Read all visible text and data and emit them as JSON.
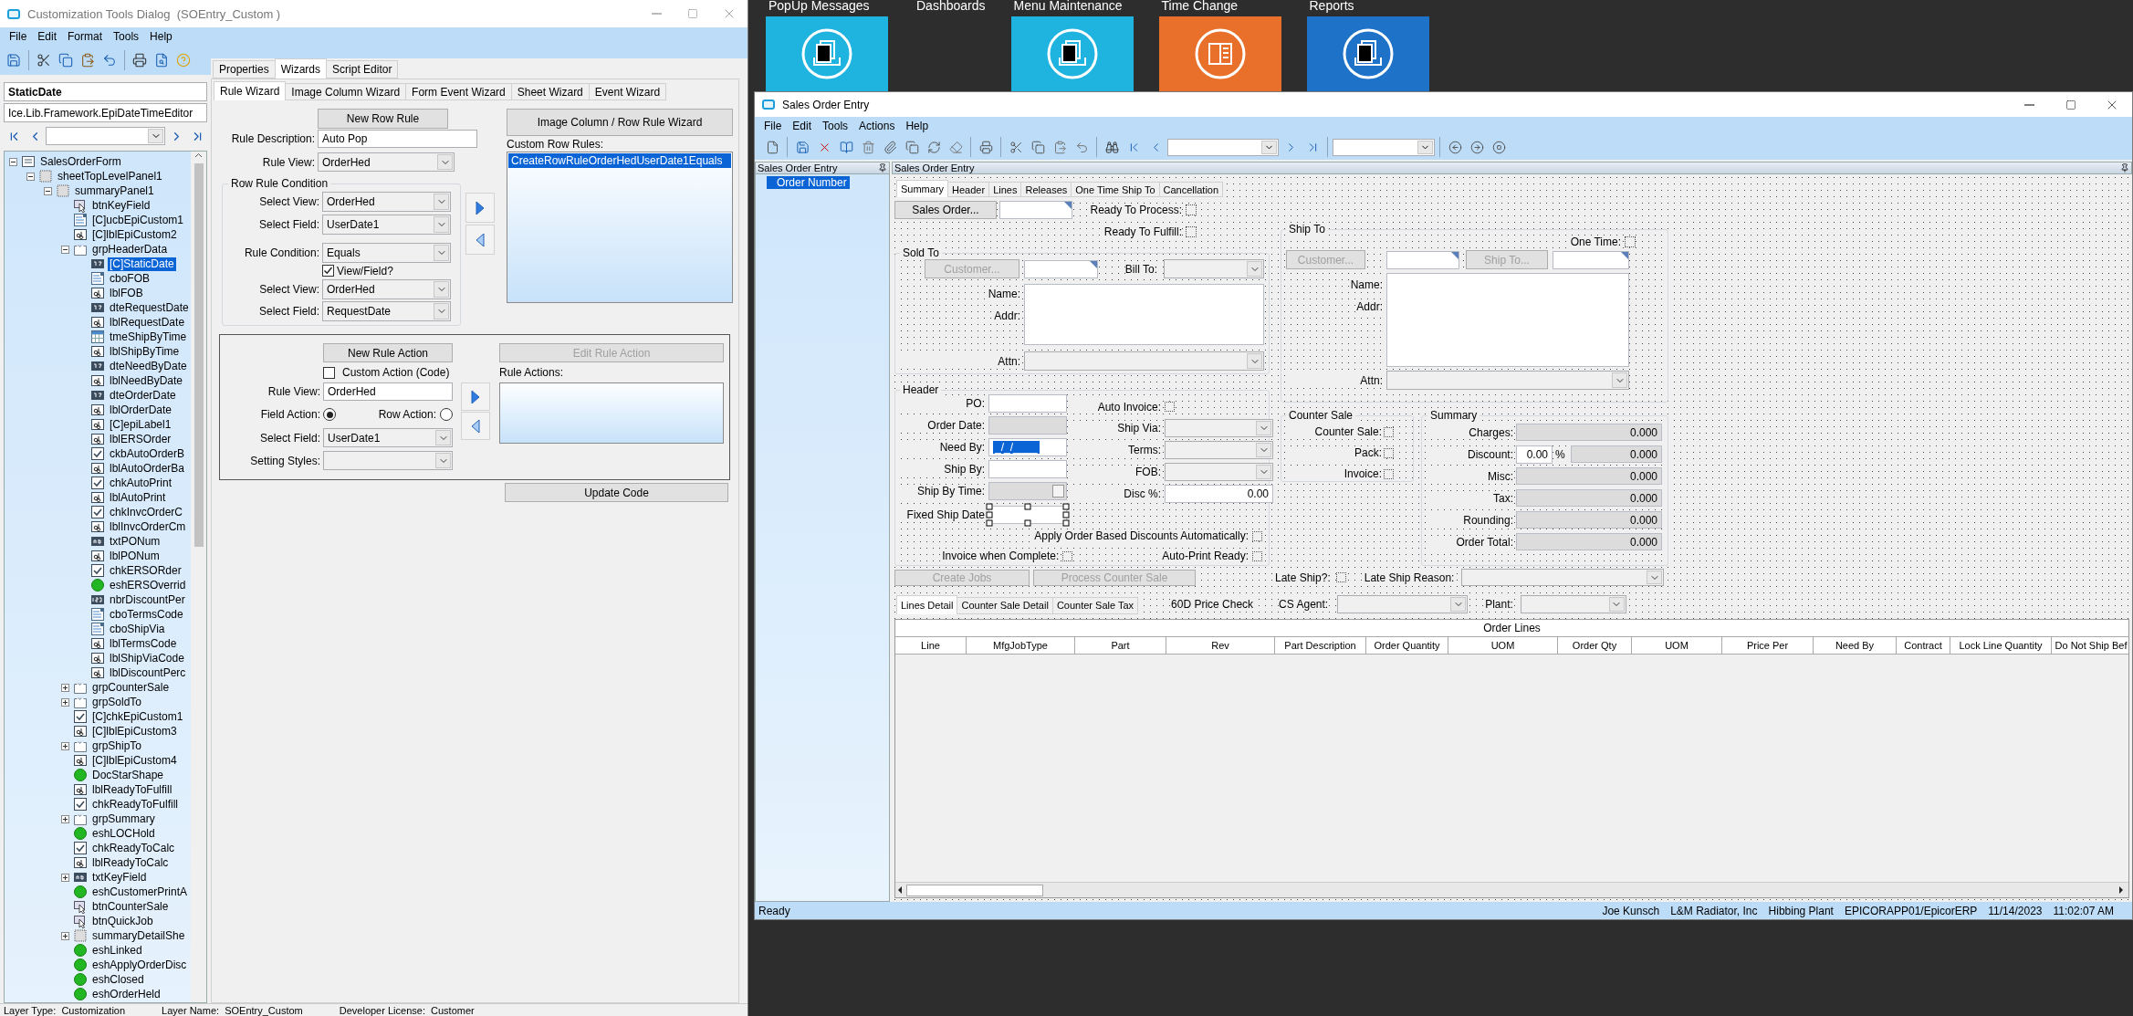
{
  "customization_dialog": {
    "title": "Customization Tools Dialog  (SOEntry_Custom )",
    "menu": [
      "File",
      "Edit",
      "Format",
      "Tools",
      "Help"
    ],
    "control_name": "StaticDate",
    "control_type": "Ice.Lib.Framework.EpiDateTimeEditor",
    "tree": [
      {
        "label": "SalesOrderForm",
        "kind": "form",
        "expanded": true,
        "selected": false,
        "children": [
          {
            "label": "sheetTopLevelPanel1",
            "kind": "panel",
            "expanded": true,
            "selected": false,
            "children": [
              {
                "label": "summaryPanel1",
                "kind": "panel",
                "expanded": true,
                "selected": false,
                "children": [
                  {
                    "label": "btnKeyField",
                    "kind": "button",
                    "selected": false
                  },
                  {
                    "label": "[C]ucbEpiCustom1",
                    "kind": "combo",
                    "selected": false
                  },
                  {
                    "label": "[C]lblEpiCustom2",
                    "kind": "label",
                    "selected": false
                  },
                  {
                    "label": "grpHeaderData",
                    "kind": "group",
                    "expanded": true,
                    "selected": false,
                    "children": [
                      {
                        "label": "[C]StaticDate",
                        "kind": "date",
                        "selected": true
                      },
                      {
                        "label": "cboFOB",
                        "kind": "combo",
                        "selected": false
                      },
                      {
                        "label": "lblFOB",
                        "kind": "label",
                        "selected": false
                      },
                      {
                        "label": "dteRequestDate",
                        "kind": "date",
                        "selected": false
                      },
                      {
                        "label": "lblRequestDate",
                        "kind": "label",
                        "selected": false
                      },
                      {
                        "label": "tmeShipByTime",
                        "kind": "time",
                        "selected": false
                      },
                      {
                        "label": "lblShipByTime",
                        "kind": "label",
                        "selected": false
                      },
                      {
                        "label": "dteNeedByDate",
                        "kind": "date",
                        "selected": false
                      },
                      {
                        "label": "lblNeedByDate",
                        "kind": "label",
                        "selected": false
                      },
                      {
                        "label": "dteOrderDate",
                        "kind": "date",
                        "selected": false
                      },
                      {
                        "label": "lblOrderDate",
                        "kind": "label",
                        "selected": false
                      },
                      {
                        "label": "[C]epiLabel1",
                        "kind": "label",
                        "selected": false
                      },
                      {
                        "label": "lblERSOrder",
                        "kind": "label",
                        "selected": false
                      },
                      {
                        "label": "ckbAutoOrderB",
                        "kind": "check",
                        "selected": false
                      },
                      {
                        "label": "lblAutoOrderBa",
                        "kind": "label",
                        "selected": false
                      },
                      {
                        "label": "chkAutoPrint",
                        "kind": "check",
                        "selected": false
                      },
                      {
                        "label": "lblAutoPrint",
                        "kind": "label",
                        "selected": false
                      },
                      {
                        "label": "chkInvcOrderC",
                        "kind": "check",
                        "selected": false
                      },
                      {
                        "label": "lblInvcOrderCm",
                        "kind": "label",
                        "selected": false
                      },
                      {
                        "label": "txtPONum",
                        "kind": "text",
                        "selected": false
                      },
                      {
                        "label": "lblPONum",
                        "kind": "label",
                        "selected": false
                      },
                      {
                        "label": "chkERSORder",
                        "kind": "check",
                        "selected": false
                      },
                      {
                        "label": "eshERSOverrid",
                        "kind": "shape",
                        "selected": false
                      },
                      {
                        "label": "nbrDiscountPer",
                        "kind": "number",
                        "selected": false
                      },
                      {
                        "label": "cboTermsCode",
                        "kind": "combo",
                        "selected": false
                      },
                      {
                        "label": "cboShipVia",
                        "kind": "combo",
                        "selected": false
                      },
                      {
                        "label": "lblTermsCode",
                        "kind": "label",
                        "selected": false
                      },
                      {
                        "label": "lblShipViaCode",
                        "kind": "label",
                        "selected": false
                      },
                      {
                        "label": "lblDiscountPerc",
                        "kind": "label",
                        "selected": false
                      }
                    ]
                  },
                  {
                    "label": "grpCounterSale",
                    "kind": "group",
                    "expanded": false,
                    "selected": false
                  },
                  {
                    "label": "grpSoldTo",
                    "kind": "group",
                    "expanded": false,
                    "selected": false
                  },
                  {
                    "label": "[C]chkEpiCustom1",
                    "kind": "check",
                    "selected": false
                  },
                  {
                    "label": "[C]lblEpiCustom3",
                    "kind": "label",
                    "selected": false
                  },
                  {
                    "label": "grpShipTo",
                    "kind": "group",
                    "expanded": false,
                    "selected": false
                  },
                  {
                    "label": "[C]lblEpiCustom4",
                    "kind": "label",
                    "selected": false
                  },
                  {
                    "label": "DocStarShape",
                    "kind": "shape",
                    "selected": false
                  },
                  {
                    "label": "lblReadyToFulfill",
                    "kind": "label",
                    "selected": false
                  },
                  {
                    "label": "chkReadyToFulfill",
                    "kind": "check",
                    "selected": false
                  },
                  {
                    "label": "grpSummary",
                    "kind": "group",
                    "expanded": false,
                    "selected": false
                  },
                  {
                    "label": "eshLOCHold",
                    "kind": "shape",
                    "selected": false
                  },
                  {
                    "label": "chkReadyToCalc",
                    "kind": "check",
                    "selected": false
                  },
                  {
                    "label": "lblReadyToCalc",
                    "kind": "label",
                    "selected": false
                  },
                  {
                    "label": "txtKeyField",
                    "kind": "text",
                    "expanded": false,
                    "selected": false
                  },
                  {
                    "label": "eshCustomerPrintA",
                    "kind": "shape",
                    "selected": false
                  },
                  {
                    "label": "btnCounterSale",
                    "kind": "button",
                    "selected": false
                  },
                  {
                    "label": "btnQuickJob",
                    "kind": "button",
                    "selected": false
                  },
                  {
                    "label": "summaryDetailShe",
                    "kind": "panel",
                    "expanded": false,
                    "selected": false
                  },
                  {
                    "label": "eshLinked",
                    "kind": "shape",
                    "selected": false
                  },
                  {
                    "label": "eshApplyOrderDisc",
                    "kind": "shape",
                    "selected": false
                  },
                  {
                    "label": "eshClosed",
                    "kind": "shape",
                    "selected": false
                  },
                  {
                    "label": "eshOrderHeld",
                    "kind": "shape",
                    "selected": false
                  }
                ]
              }
            ]
          }
        ]
      }
    ],
    "tabs": [
      {
        "label": "Properties",
        "selected": false
      },
      {
        "label": "Wizards",
        "selected": true
      },
      {
        "label": "Script Editor",
        "selected": false
      }
    ],
    "wizard_tabs": [
      {
        "label": "Rule Wizard",
        "selected": true
      },
      {
        "label": "Image Column Wizard",
        "selected": false
      },
      {
        "label": "Form Event Wizard",
        "selected": false
      },
      {
        "label": "Sheet Wizard",
        "selected": false
      },
      {
        "label": "Event Wizard",
        "selected": false
      }
    ],
    "rule_wizard": {
      "new_row_rule": "New Row Rule",
      "rule_description": {
        "label": "Rule Description:",
        "value": "Auto Pop"
      },
      "rule_view": {
        "label": "Rule View:",
        "value": "OrderHed"
      },
      "condition": {
        "title": "Row Rule Condition",
        "select_view": {
          "label": "Select View:",
          "value": "OrderHed"
        },
        "select_field": {
          "label": "Select Field:",
          "value": "UserDate1"
        },
        "rule_condition": {
          "label": "Rule Condition:",
          "value": "Equals"
        },
        "view_field": {
          "label": "View/Field?",
          "checked": true
        },
        "select_view_2": {
          "label": "Select View:",
          "value": "OrderHed"
        },
        "select_field_2": {
          "label": "Select Field:",
          "value": "RequestDate"
        }
      },
      "image_column_button": "Image Column / Row Rule Wizard",
      "custom_row_rules": {
        "label": "Custom Row Rules:",
        "items": [
          {
            "label": "CreateRowRuleOrderHedUserDate1Equals",
            "selected": true
          }
        ]
      },
      "action": {
        "new_rule_action": "New Rule Action",
        "edit_rule_action": {
          "label": "Edit Rule Action",
          "disabled": true
        },
        "custom_action": {
          "label": "Custom Action (Code)",
          "checked": false
        },
        "rule_actions_label": "Rule Actions:",
        "rule_view": {
          "label": "Rule View:",
          "value": "OrderHed"
        },
        "field_action": {
          "label": "Field Action:",
          "selected": true
        },
        "row_action": {
          "label": "Row Action:",
          "selected": false
        },
        "select_field": {
          "label": "Select Field:",
          "value": "UserDate1"
        },
        "setting_styles": {
          "label": "Setting Styles:"
        }
      },
      "update_code": "Update Code"
    },
    "status_bar": [
      "Layer Type:  Customization",
      "Layer Name:  SOEntry_Custom",
      "Developer License:  Customer"
    ]
  },
  "desktop": {
    "tiles": [
      {
        "label": "PopUp Messages",
        "color": "#1fb3e0",
        "kind": "documents"
      },
      {
        "label": "Dashboards"
      },
      {
        "label": "Menu Maintenance",
        "color": "#1fb3e0",
        "kind": "documents"
      },
      {
        "label": "Time Change",
        "color": "#e9702a",
        "kind": "sheet"
      },
      {
        "label": "Reports",
        "color": "#1e72c8",
        "kind": "documents"
      }
    ]
  },
  "sales_order_entry": {
    "title": "Sales Order Entry",
    "menu": [
      "File",
      "Edit",
      "Tools",
      "Actions",
      "Help"
    ],
    "left_pane": {
      "title": "Sales Order Entry",
      "items": [
        {
          "label": "Order Number",
          "selected": true
        }
      ]
    },
    "main_title": "Sales Order Entry",
    "tabs": [
      {
        "label": "Summary",
        "selected": true
      },
      {
        "label": "Header",
        "selected": false
      },
      {
        "label": "Lines",
        "selected": false
      },
      {
        "label": "Releases",
        "selected": false
      },
      {
        "label": "One Time Ship To",
        "selected": false
      },
      {
        "label": "Cancellation",
        "selected": false
      }
    ],
    "sales_order_button": "Sales Order...",
    "ready_to_process": {
      "label": "Ready To Process:",
      "checked": false
    },
    "ready_to_fulfill": {
      "label": "Ready To Fulfill:",
      "checked": false
    },
    "sold_to": {
      "title": "Sold To",
      "customer_button": {
        "label": "Customer...",
        "disabled": true
      },
      "bill_to_label": "Bill To:",
      "name_label": "Name:",
      "addr_label": "Addr:",
      "attn_label": "Attn:"
    },
    "header": {
      "title": "Header",
      "left": [
        {
          "label": "PO:",
          "kind": "text",
          "disabled": false
        },
        {
          "label": "Order Date:",
          "kind": "text",
          "disabled": true
        },
        {
          "label": "Need By:",
          "kind": "masked",
          "value": "_/_/____"
        },
        {
          "label": "Ship By:",
          "kind": "text",
          "disabled": false
        },
        {
          "label": "Ship By Time:",
          "kind": "spin"
        },
        {
          "label": "Fixed Ship Date",
          "kind": "text",
          "disabled": false,
          "selected": true
        }
      ],
      "right": [
        {
          "label": "Auto Invoice:",
          "kind": "check",
          "checked": false
        },
        {
          "label": "Ship Via:",
          "kind": "combo"
        },
        {
          "label": "Terms:",
          "kind": "combo"
        },
        {
          "label": "FOB:",
          "kind": "combo"
        },
        {
          "label": "Disc %:",
          "kind": "number",
          "value": "0.00"
        }
      ],
      "apply_discounts": {
        "label": "Apply Order Based Discounts Automatically:",
        "checked": false
      },
      "invoice_when_complete": {
        "label": "Invoice when Complete:",
        "checked": false
      },
      "auto_print_ready": {
        "label": "Auto-Print Ready:",
        "checked": false
      }
    },
    "ship_to": {
      "title": "Ship To",
      "one_time": {
        "label": "One Time:",
        "checked": false
      },
      "customer_button": {
        "label": "Customer...",
        "disabled": true
      },
      "ship_to_button": {
        "label": "Ship To...",
        "disabled": true
      },
      "name_label": "Name:",
      "addr_label": "Addr:",
      "attn_label": "Attn:"
    },
    "counter_sale": {
      "title": "Counter Sale",
      "items": [
        {
          "label": "Counter Sale:",
          "checked": false
        },
        {
          "label": "Pack:",
          "checked": false
        },
        {
          "label": "Invoice:",
          "checked": false
        }
      ]
    },
    "summary": {
      "title": "Summary",
      "rows": [
        {
          "label": "Charges:",
          "value": "0.000"
        },
        {
          "label": "Discount:",
          "percent": "0.00",
          "percent_sign": "%",
          "value": "0.000"
        },
        {
          "label": "Misc:",
          "value": "0.000"
        },
        {
          "label": "Tax:",
          "value": "0.000"
        },
        {
          "label": "Rounding:",
          "value": "0.000"
        },
        {
          "label": "Order Total:",
          "value": "0.000"
        }
      ]
    },
    "create_jobs": {
      "label": "Create Jobs",
      "disabled": true
    },
    "process_counter_sale": {
      "label": "Process Counter Sale",
      "disabled": true
    },
    "late_ship": {
      "label": "Late Ship?:",
      "checked": false
    },
    "late_ship_reason_label": "Late Ship Reason:",
    "line_tabs": [
      {
        "label": "Lines Detail",
        "selected": true
      },
      {
        "label": "Counter Sale Detail",
        "selected": false
      },
      {
        "label": "Counter Sale Tax",
        "selected": false
      }
    ],
    "price_check_label": "60D Price Check",
    "cs_agent_label": "CS Agent:",
    "plant_label": "Plant:",
    "grid": {
      "title": "Order Lines",
      "columns": [
        "Line",
        "MfgJobType",
        "Part",
        "Rev",
        "Part Description",
        "Order Quantity",
        "UOM",
        "Order Qty",
        "UOM",
        "Price Per",
        "Need By",
        "Contract",
        "Lock Line Quantity",
        "Do Not Ship Bef"
      ]
    },
    "status_bar": {
      "message": "Ready",
      "items": [
        "Joe Kunsch",
        "L&M Radiator, Inc",
        "Hibbing Plant",
        "EPICORAPP01/EpicorERP",
        "11/14/2023",
        "11:02:07 AM"
      ]
    }
  }
}
